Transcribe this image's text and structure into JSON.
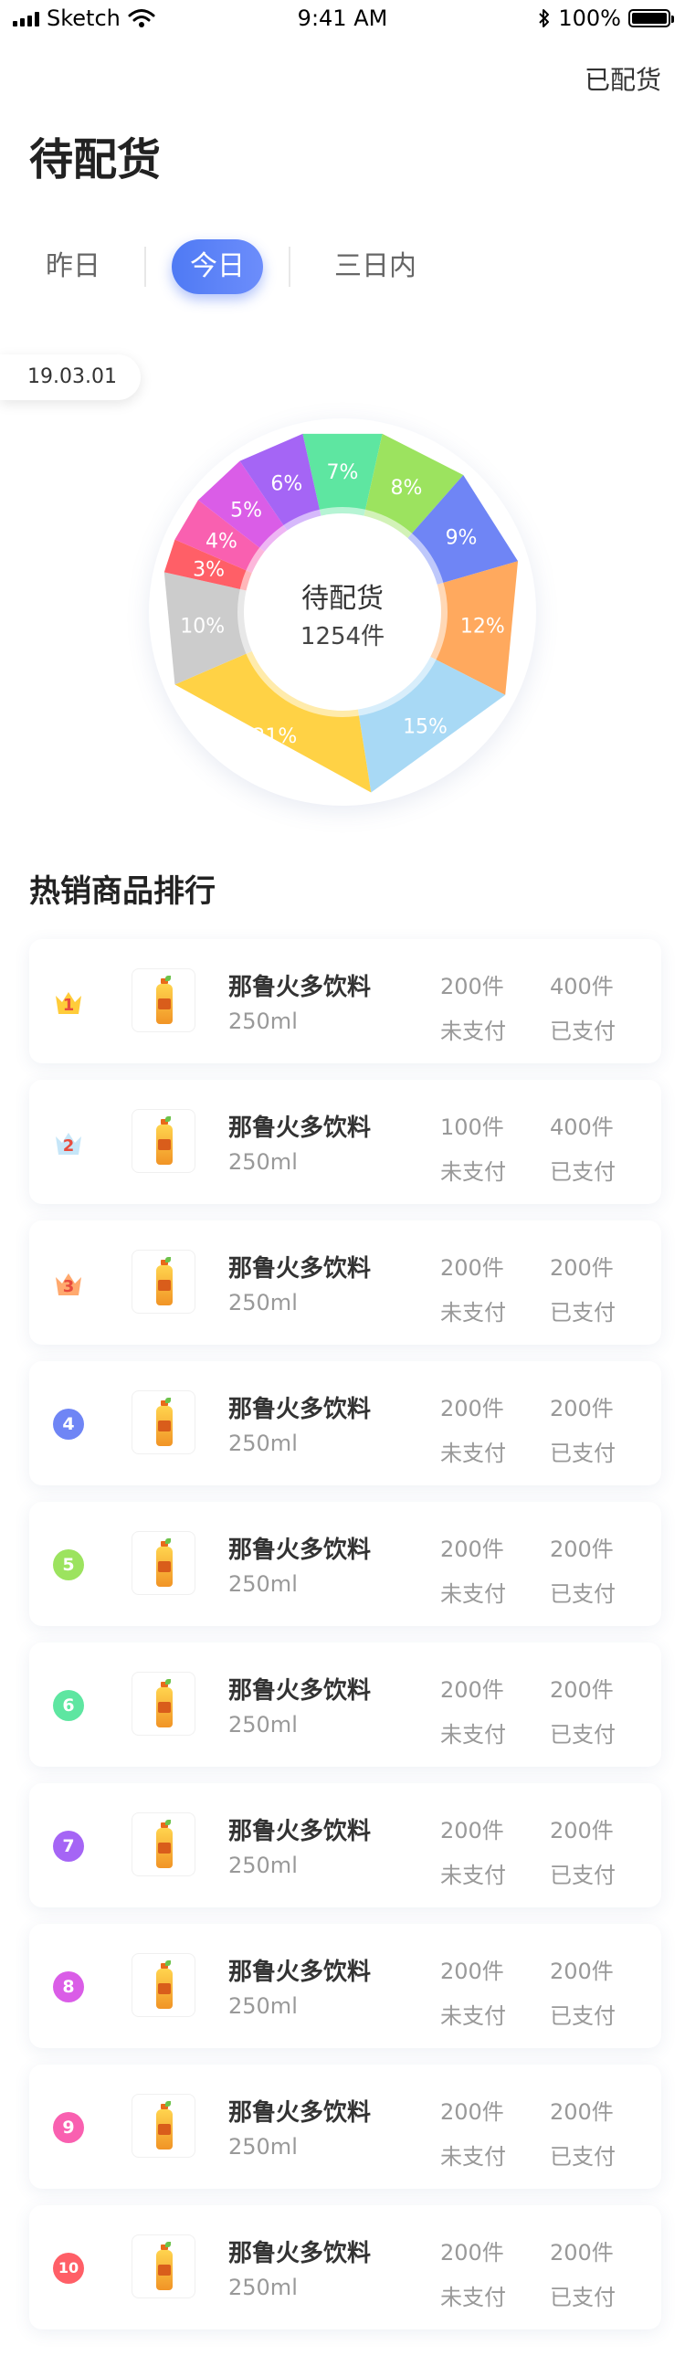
{
  "status_bar": {
    "carrier": "Sketch",
    "time": "9:41 AM",
    "battery": "100%"
  },
  "header": {
    "action_label": "已配货",
    "title": "待配货"
  },
  "tabs": [
    {
      "label": "昨日",
      "active": false
    },
    {
      "label": "今日",
      "active": true
    },
    {
      "label": "三日内",
      "active": false
    }
  ],
  "date_label": "19.03.01",
  "chart_data": {
    "type": "pie",
    "center_title": "待配货",
    "center_value": "1254件",
    "slices": [
      {
        "label": "7%",
        "value": 7,
        "color": "#5ee6a1"
      },
      {
        "label": "8%",
        "value": 8,
        "color": "#9ce35f"
      },
      {
        "label": "9%",
        "value": 9,
        "color": "#6f85f5"
      },
      {
        "label": "12%",
        "value": 12,
        "color": "#ffa95e"
      },
      {
        "label": "15%",
        "value": 15,
        "color": "#a8d9f5"
      },
      {
        "label": "21%",
        "value": 21,
        "color": "#ffd245"
      },
      {
        "label": "10%",
        "value": 10,
        "color": "#cccccc"
      },
      {
        "label": "3%",
        "value": 3,
        "color": "#ff5f67"
      },
      {
        "label": "4%",
        "value": 4,
        "color": "#f960b0"
      },
      {
        "label": "5%",
        "value": 5,
        "color": "#da5de7"
      },
      {
        "label": "6%",
        "value": 6,
        "color": "#a565f5"
      }
    ]
  },
  "ranking": {
    "title": "热销商品排行",
    "items": [
      {
        "rank": "1",
        "name": "那鲁火多饮料",
        "size": "250ml",
        "unpaid_qty": "200件",
        "unpaid_label": "未支付",
        "paid_qty": "400件",
        "paid_label": "已支付",
        "badge_color": "#ffcc3a"
      },
      {
        "rank": "2",
        "name": "那鲁火多饮料",
        "size": "250ml",
        "unpaid_qty": "100件",
        "unpaid_label": "未支付",
        "paid_qty": "400件",
        "paid_label": "已支付",
        "badge_color": "#c6e6f8"
      },
      {
        "rank": "3",
        "name": "那鲁火多饮料",
        "size": "250ml",
        "unpaid_qty": "200件",
        "unpaid_label": "未支付",
        "paid_qty": "200件",
        "paid_label": "已支付",
        "badge_color": "#ffa96e"
      },
      {
        "rank": "4",
        "name": "那鲁火多饮料",
        "size": "250ml",
        "unpaid_qty": "200件",
        "unpaid_label": "未支付",
        "paid_qty": "200件",
        "paid_label": "已支付",
        "badge_color": "#6f85f5"
      },
      {
        "rank": "5",
        "name": "那鲁火多饮料",
        "size": "250ml",
        "unpaid_qty": "200件",
        "unpaid_label": "未支付",
        "paid_qty": "200件",
        "paid_label": "已支付",
        "badge_color": "#9ce35f"
      },
      {
        "rank": "6",
        "name": "那鲁火多饮料",
        "size": "250ml",
        "unpaid_qty": "200件",
        "unpaid_label": "未支付",
        "paid_qty": "200件",
        "paid_label": "已支付",
        "badge_color": "#5ee6a1"
      },
      {
        "rank": "7",
        "name": "那鲁火多饮料",
        "size": "250ml",
        "unpaid_qty": "200件",
        "unpaid_label": "未支付",
        "paid_qty": "200件",
        "paid_label": "已支付",
        "badge_color": "#a565f5"
      },
      {
        "rank": "8",
        "name": "那鲁火多饮料",
        "size": "250ml",
        "unpaid_qty": "200件",
        "unpaid_label": "未支付",
        "paid_qty": "200件",
        "paid_label": "已支付",
        "badge_color": "#da5de7"
      },
      {
        "rank": "9",
        "name": "那鲁火多饮料",
        "size": "250ml",
        "unpaid_qty": "200件",
        "unpaid_label": "未支付",
        "paid_qty": "200件",
        "paid_label": "已支付",
        "badge_color": "#f960b0"
      },
      {
        "rank": "10",
        "name": "那鲁火多饮料",
        "size": "250ml",
        "unpaid_qty": "200件",
        "unpaid_label": "未支付",
        "paid_qty": "200件",
        "paid_label": "已支付",
        "badge_color": "#ff5f67"
      }
    ]
  }
}
